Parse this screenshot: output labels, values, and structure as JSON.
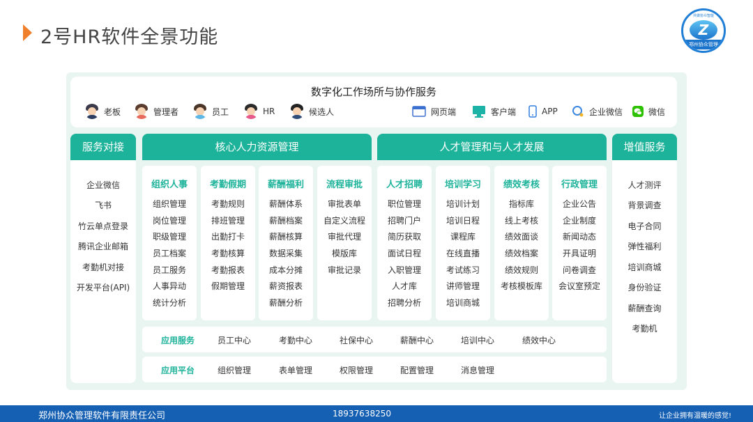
{
  "page": {
    "title": "2号HR软件全景功能"
  },
  "logo": {
    "ring_text": "共做协众智能",
    "letter": "Z",
    "band_text": "郑州协众管理"
  },
  "top": {
    "title": "数字化工作场所与协作服务",
    "users": [
      "老板",
      "管理者",
      "员工",
      "HR",
      "候选人"
    ],
    "clients": [
      "网页端",
      "客户端",
      "APP",
      "企业微信",
      "微信"
    ]
  },
  "service": {
    "header": "服务对接",
    "items": [
      "企业微信",
      "飞书",
      "竹云单点登录",
      "腾讯企业邮箱",
      "考勤机对接",
      "开发平台(API)"
    ]
  },
  "core": {
    "header": "核心人力资源管理",
    "columns": [
      {
        "title": "组织人事",
        "items": [
          "组织管理",
          "岗位管理",
          "职级管理",
          "员工档案",
          "员工服务",
          "人事异动",
          "统计分析"
        ]
      },
      {
        "title": "考勤假期",
        "items": [
          "考勤规则",
          "排班管理",
          "出勤打卡",
          "考勤核算",
          "考勤报表",
          "假期管理"
        ]
      },
      {
        "title": "薪酬福利",
        "items": [
          "薪酬体系",
          "薪酬档案",
          "薪酬核算",
          "数据采集",
          "成本分摊",
          "薪资报表",
          "薪酬分析"
        ]
      },
      {
        "title": "流程审批",
        "items": [
          "审批表单",
          "自定义流程",
          "审批代理",
          "模版库",
          "审批记录"
        ]
      }
    ]
  },
  "talent": {
    "header": "人才管理和与人才发展",
    "columns": [
      {
        "title": "人才招聘",
        "items": [
          "职位管理",
          "招聘门户",
          "简历获取",
          "面试日程",
          "入职管理",
          "人才库",
          "招聘分析"
        ]
      },
      {
        "title": "培训学习",
        "items": [
          "培训计划",
          "培训日程",
          "课程库",
          "在线直播",
          "考试练习",
          "讲师管理",
          "培训商城"
        ]
      },
      {
        "title": "绩效考核",
        "items": [
          "指标库",
          "线上考核",
          "绩效面谈",
          "绩效档案",
          "绩效规则",
          "考核模板库"
        ]
      },
      {
        "title": "行政管理",
        "items": [
          "企业公告",
          "企业制度",
          "新闻动态",
          "开具证明",
          "问卷调查",
          "会议室预定"
        ]
      }
    ]
  },
  "value_added": {
    "header": "增值服务",
    "items": [
      "人才测评",
      "背景调查",
      "电子合同",
      "弹性福利",
      "培训商城",
      "身份验证",
      "薪酬查询",
      "考勤机"
    ]
  },
  "app_service": {
    "label": "应用服务",
    "items": [
      "员工中心",
      "考勤中心",
      "社保中心",
      "薪酬中心",
      "培训中心",
      "绩效中心"
    ]
  },
  "app_platform": {
    "label": "应用平台",
    "items": [
      "组织管理",
      "表单管理",
      "权限管理",
      "配置管理",
      "消息管理"
    ]
  },
  "footer": {
    "company": "郑州协众管理软件有限责任公司",
    "phone": "18937638250",
    "slogan": "让企业拥有温暖的感觉!"
  },
  "colors": {
    "accent_green": "#1db39a",
    "footer_blue": "#1660b3",
    "title_arrow": "#f07f2c"
  }
}
